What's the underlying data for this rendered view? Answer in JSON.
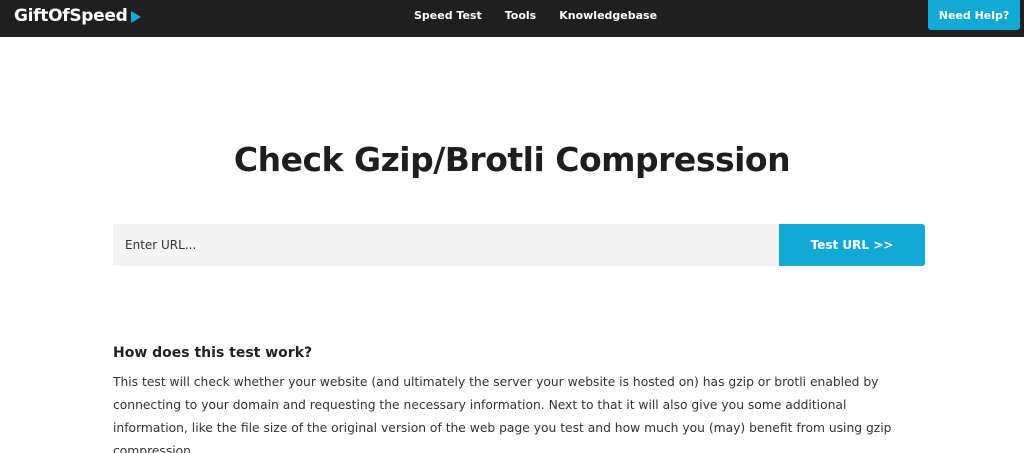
{
  "header": {
    "logo_text": "GiftOfSpeed",
    "nav": [
      {
        "label": "Speed Test"
      },
      {
        "label": "Tools"
      },
      {
        "label": "Knowledgebase"
      }
    ],
    "help_label": "Need Help?"
  },
  "main": {
    "title": "Check Gzip/Brotli Compression",
    "url_input": {
      "value": "",
      "placeholder": "Enter URL..."
    },
    "test_button_label": "Test URL >>",
    "how": {
      "heading": "How does this test work?",
      "text": "This test will check whether your website (and ultimately the server your website is hosted on) has gzip or brotli enabled by connecting to your domain and requesting the necessary information. Next to that it will also give you some additional information, like the file size of the original version of the web page you test and how much you (may) benefit from using gzip compression."
    }
  },
  "colors": {
    "accent": "#13a9d6",
    "navbar": "#1f1f1f"
  }
}
